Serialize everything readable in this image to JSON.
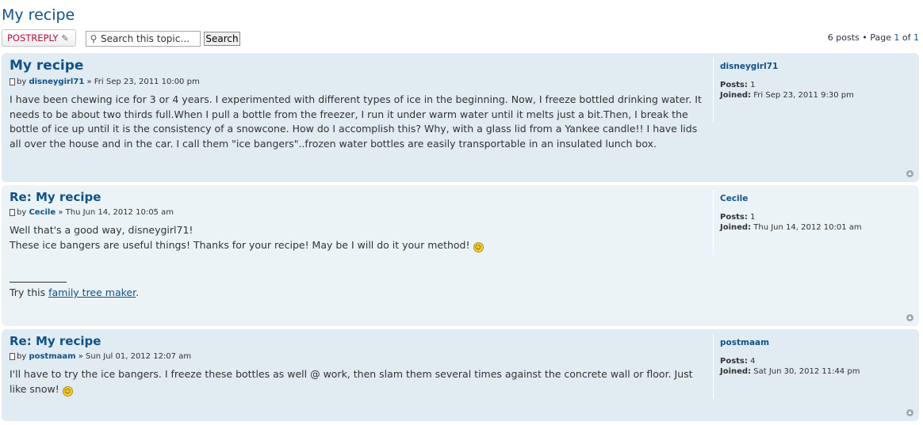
{
  "page": {
    "title": "My recipe"
  },
  "toolbar": {
    "post_reply_label": "POSTREPLY",
    "search_placeholder": "Search this topic…",
    "search_button_label": "Search"
  },
  "pagination": {
    "posts_text": "6 posts",
    "page_label": "Page",
    "current_page": "1",
    "of_label": "of",
    "total_pages": "1"
  },
  "posts": [
    {
      "title": "My recipe",
      "by_label": "by",
      "author": "disneygirl71",
      "date": "» Fri Sep 23, 2011 10:00 pm",
      "content": "I have been chewing ice for 3 or 4 years. I experimented with different types of ice in the beginning. Now, I freeze bottled drinking water. It needs to be about two thirds full.When I pull a bottle from the freezer, I run it under warm water until it melts just a bit.Then, I break the bottle of ice up until it is the consistency of a snowcone. How do I accomplish this? Why, with a glass lid from a Yankee candle!! I have lids all over the house and in the car. I call them \"ice bangers\"..frozen water bottles are easily transportable in an insulated lunch box.",
      "profile": {
        "name": "disneygirl71",
        "posts_label": "Posts:",
        "posts": "1",
        "joined_label": "Joined:",
        "joined": "Fri Sep 23, 2011 9:30 pm"
      }
    },
    {
      "title": "Re: My recipe",
      "by_label": "by",
      "author": "Cecile",
      "date": "» Thu Jun 14, 2012 10:05 am",
      "content_line1": "Well that's a good way, disneygirl71!",
      "content_line2": "These ice bangers are useful things! Thanks for your recipe! May be I will do it your method!",
      "signature_prefix": "Try this",
      "signature_link": "family tree maker",
      "signature_suffix": ".",
      "profile": {
        "name": "Cecile",
        "posts_label": "Posts:",
        "posts": "1",
        "joined_label": "Joined:",
        "joined": "Thu Jun 14, 2012 10:01 am"
      }
    },
    {
      "title": "Re: My recipe",
      "by_label": "by",
      "author": "postmaam",
      "date": "» Sun Jul 01, 2012 12:07 am",
      "content": "I'll have to try the ice bangers. I freeze these bottles as well @ work, then slam them several times against the concrete wall or floor. Just like snow!",
      "profile": {
        "name": "postmaam",
        "posts_label": "Posts:",
        "posts": "4",
        "joined_label": "Joined:",
        "joined": "Sat Jun 30, 2012 11:44 pm"
      }
    }
  ],
  "icons": {
    "post": "post-icon",
    "smiley": "smiley-icon",
    "top": "back-to-top-icon",
    "search": "search-icon",
    "pencil": "pencil-icon"
  },
  "colors": {
    "link": "#105289",
    "post_reply": "#b3123b",
    "post_bg_dark": "#e1ebf2",
    "post_bg_light": "#ecf3f7"
  }
}
